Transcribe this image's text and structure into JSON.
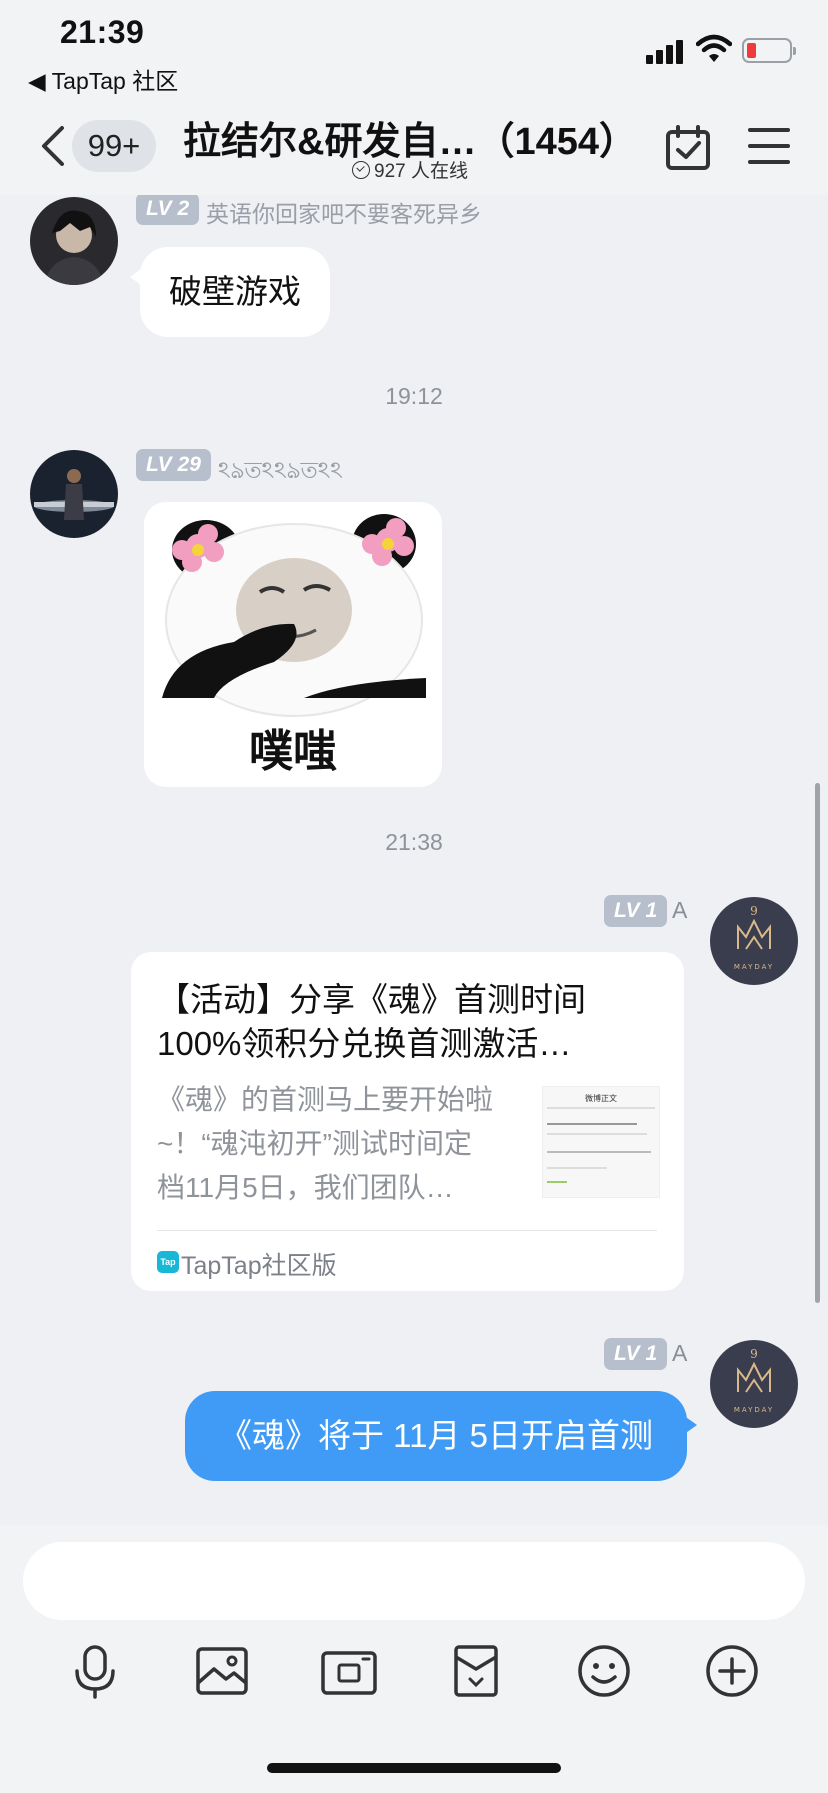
{
  "status_bar": {
    "time": "21:39",
    "back_app": "◀ TapTap 社区"
  },
  "nav": {
    "unread": "99+",
    "title": "拉结尔&研发自…（1454）",
    "online_count": "927",
    "online_text": "人在线",
    "icons": [
      "back-chevron-icon",
      "calendar-check-icon",
      "menu-icon"
    ]
  },
  "messages": [
    {
      "type": "text",
      "side": "left",
      "level": "LV 2",
      "nickname": "英语你回家吧不要客死异乡",
      "text": "破壁游戏"
    },
    {
      "type": "time",
      "text": "19:12"
    },
    {
      "type": "sticker",
      "side": "left",
      "level": "LV 29",
      "nickname": "ঽঌতঽঽঌতঽঽ",
      "caption": "噗嗤"
    },
    {
      "type": "time",
      "text": "21:38"
    },
    {
      "type": "card",
      "side": "right",
      "level": "LV 1",
      "nickname": "A",
      "title": "【活动】分享《魂》首测时间100%领积分兑换首测激活…",
      "description": "《魂》的首测马上要开始啦~！“魂沌初开”测试时间定档11月5日，我们团队…",
      "thumb_title": "微博正文",
      "source": "TapTap社区版",
      "source_icon": "Tap"
    },
    {
      "type": "text",
      "side": "right",
      "level": "LV 1",
      "nickname": "A",
      "text": "《魂》将于 11月 5日开启首测"
    }
  ],
  "input": {
    "placeholder": "",
    "tools": [
      "microphone-icon",
      "image-icon",
      "photo-camera-icon",
      "sticker-pack-icon",
      "emoji-icon",
      "plus-icon"
    ]
  },
  "colors": {
    "accent": "#3f9bf5",
    "background": "#eef0f3",
    "level_badge": "#b8bfcc",
    "battery_low": "#ef3b3b"
  }
}
